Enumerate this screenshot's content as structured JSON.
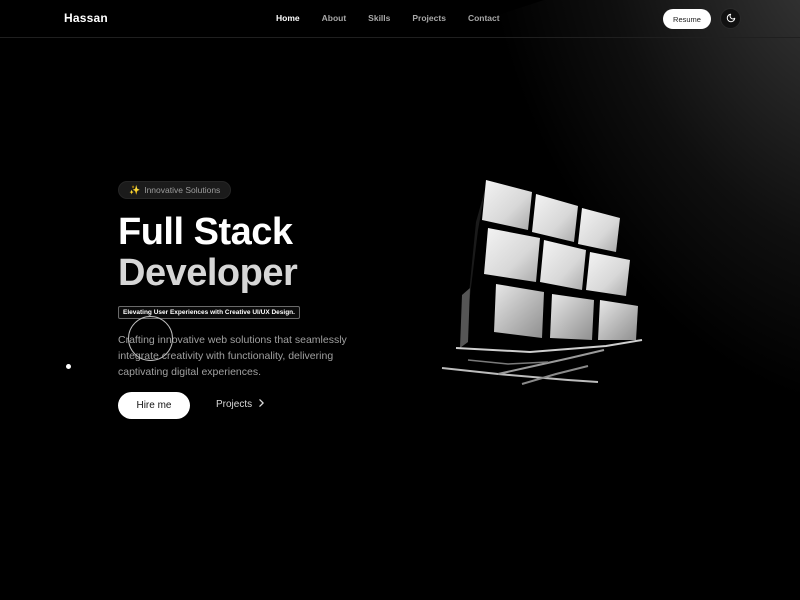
{
  "header": {
    "logo": "Hassan",
    "nav": [
      {
        "label": "Home",
        "active": true
      },
      {
        "label": "About",
        "active": false
      },
      {
        "label": "Skills",
        "active": false
      },
      {
        "label": "Projects",
        "active": false
      },
      {
        "label": "Contact",
        "active": false
      }
    ],
    "resume_label": "Resume",
    "theme_icon": "moon-icon"
  },
  "hero": {
    "badge_icon": "sparkle-icon",
    "badge_text": "Innovative Solutions",
    "title_line1": "Full Stack",
    "title_line2": "Developer",
    "tagline": "Elevating User Experiences with Creative UI/UX Design.",
    "description": "Crafting innovative web solutions that seamlessly integrate creativity with functionality, delivering captivating digital experiences.",
    "hire_label": "Hire me",
    "projects_label": "Projects",
    "projects_icon": "chevron-right-icon",
    "illustration": "rubiks-cube-image"
  },
  "colors": {
    "background": "#000000",
    "text": "#ffffff",
    "muted": "#a0a0a0",
    "button_bg": "#ffffff"
  }
}
